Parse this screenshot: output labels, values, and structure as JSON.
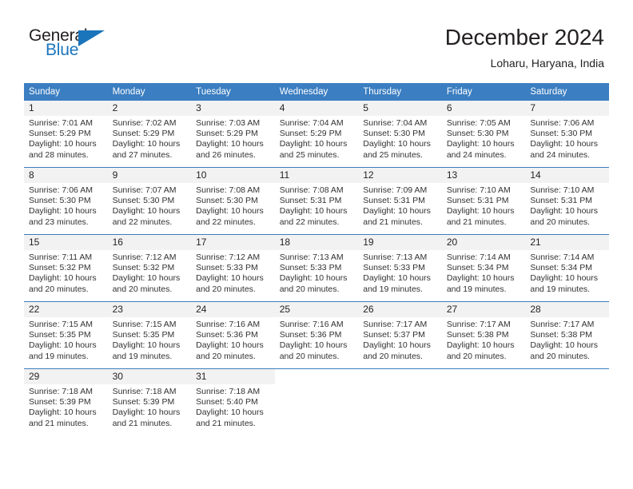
{
  "brand": {
    "name_part1": "General",
    "name_part2": "Blue",
    "accent_color": "#1b75bb",
    "logo_icon": "triangle-flag-icon"
  },
  "header": {
    "month_title": "December 2024",
    "location": "Loharu, Haryana, India"
  },
  "calendar": {
    "header_bg_color": "#3b7ec1",
    "daynum_bg_color": "#f2f2f2",
    "weekday_headers": [
      "Sunday",
      "Monday",
      "Tuesday",
      "Wednesday",
      "Thursday",
      "Friday",
      "Saturday"
    ],
    "weeks": [
      [
        {
          "day": "1",
          "sunrise": "Sunrise: 7:01 AM",
          "sunset": "Sunset: 5:29 PM",
          "daylight_line1": "Daylight: 10 hours",
          "daylight_line2": "and 28 minutes."
        },
        {
          "day": "2",
          "sunrise": "Sunrise: 7:02 AM",
          "sunset": "Sunset: 5:29 PM",
          "daylight_line1": "Daylight: 10 hours",
          "daylight_line2": "and 27 minutes."
        },
        {
          "day": "3",
          "sunrise": "Sunrise: 7:03 AM",
          "sunset": "Sunset: 5:29 PM",
          "daylight_line1": "Daylight: 10 hours",
          "daylight_line2": "and 26 minutes."
        },
        {
          "day": "4",
          "sunrise": "Sunrise: 7:04 AM",
          "sunset": "Sunset: 5:29 PM",
          "daylight_line1": "Daylight: 10 hours",
          "daylight_line2": "and 25 minutes."
        },
        {
          "day": "5",
          "sunrise": "Sunrise: 7:04 AM",
          "sunset": "Sunset: 5:30 PM",
          "daylight_line1": "Daylight: 10 hours",
          "daylight_line2": "and 25 minutes."
        },
        {
          "day": "6",
          "sunrise": "Sunrise: 7:05 AM",
          "sunset": "Sunset: 5:30 PM",
          "daylight_line1": "Daylight: 10 hours",
          "daylight_line2": "and 24 minutes."
        },
        {
          "day": "7",
          "sunrise": "Sunrise: 7:06 AM",
          "sunset": "Sunset: 5:30 PM",
          "daylight_line1": "Daylight: 10 hours",
          "daylight_line2": "and 24 minutes."
        }
      ],
      [
        {
          "day": "8",
          "sunrise": "Sunrise: 7:06 AM",
          "sunset": "Sunset: 5:30 PM",
          "daylight_line1": "Daylight: 10 hours",
          "daylight_line2": "and 23 minutes."
        },
        {
          "day": "9",
          "sunrise": "Sunrise: 7:07 AM",
          "sunset": "Sunset: 5:30 PM",
          "daylight_line1": "Daylight: 10 hours",
          "daylight_line2": "and 22 minutes."
        },
        {
          "day": "10",
          "sunrise": "Sunrise: 7:08 AM",
          "sunset": "Sunset: 5:30 PM",
          "daylight_line1": "Daylight: 10 hours",
          "daylight_line2": "and 22 minutes."
        },
        {
          "day": "11",
          "sunrise": "Sunrise: 7:08 AM",
          "sunset": "Sunset: 5:31 PM",
          "daylight_line1": "Daylight: 10 hours",
          "daylight_line2": "and 22 minutes."
        },
        {
          "day": "12",
          "sunrise": "Sunrise: 7:09 AM",
          "sunset": "Sunset: 5:31 PM",
          "daylight_line1": "Daylight: 10 hours",
          "daylight_line2": "and 21 minutes."
        },
        {
          "day": "13",
          "sunrise": "Sunrise: 7:10 AM",
          "sunset": "Sunset: 5:31 PM",
          "daylight_line1": "Daylight: 10 hours",
          "daylight_line2": "and 21 minutes."
        },
        {
          "day": "14",
          "sunrise": "Sunrise: 7:10 AM",
          "sunset": "Sunset: 5:31 PM",
          "daylight_line1": "Daylight: 10 hours",
          "daylight_line2": "and 20 minutes."
        }
      ],
      [
        {
          "day": "15",
          "sunrise": "Sunrise: 7:11 AM",
          "sunset": "Sunset: 5:32 PM",
          "daylight_line1": "Daylight: 10 hours",
          "daylight_line2": "and 20 minutes."
        },
        {
          "day": "16",
          "sunrise": "Sunrise: 7:12 AM",
          "sunset": "Sunset: 5:32 PM",
          "daylight_line1": "Daylight: 10 hours",
          "daylight_line2": "and 20 minutes."
        },
        {
          "day": "17",
          "sunrise": "Sunrise: 7:12 AM",
          "sunset": "Sunset: 5:33 PM",
          "daylight_line1": "Daylight: 10 hours",
          "daylight_line2": "and 20 minutes."
        },
        {
          "day": "18",
          "sunrise": "Sunrise: 7:13 AM",
          "sunset": "Sunset: 5:33 PM",
          "daylight_line1": "Daylight: 10 hours",
          "daylight_line2": "and 20 minutes."
        },
        {
          "day": "19",
          "sunrise": "Sunrise: 7:13 AM",
          "sunset": "Sunset: 5:33 PM",
          "daylight_line1": "Daylight: 10 hours",
          "daylight_line2": "and 19 minutes."
        },
        {
          "day": "20",
          "sunrise": "Sunrise: 7:14 AM",
          "sunset": "Sunset: 5:34 PM",
          "daylight_line1": "Daylight: 10 hours",
          "daylight_line2": "and 19 minutes."
        },
        {
          "day": "21",
          "sunrise": "Sunrise: 7:14 AM",
          "sunset": "Sunset: 5:34 PM",
          "daylight_line1": "Daylight: 10 hours",
          "daylight_line2": "and 19 minutes."
        }
      ],
      [
        {
          "day": "22",
          "sunrise": "Sunrise: 7:15 AM",
          "sunset": "Sunset: 5:35 PM",
          "daylight_line1": "Daylight: 10 hours",
          "daylight_line2": "and 19 minutes."
        },
        {
          "day": "23",
          "sunrise": "Sunrise: 7:15 AM",
          "sunset": "Sunset: 5:35 PM",
          "daylight_line1": "Daylight: 10 hours",
          "daylight_line2": "and 19 minutes."
        },
        {
          "day": "24",
          "sunrise": "Sunrise: 7:16 AM",
          "sunset": "Sunset: 5:36 PM",
          "daylight_line1": "Daylight: 10 hours",
          "daylight_line2": "and 20 minutes."
        },
        {
          "day": "25",
          "sunrise": "Sunrise: 7:16 AM",
          "sunset": "Sunset: 5:36 PM",
          "daylight_line1": "Daylight: 10 hours",
          "daylight_line2": "and 20 minutes."
        },
        {
          "day": "26",
          "sunrise": "Sunrise: 7:17 AM",
          "sunset": "Sunset: 5:37 PM",
          "daylight_line1": "Daylight: 10 hours",
          "daylight_line2": "and 20 minutes."
        },
        {
          "day": "27",
          "sunrise": "Sunrise: 7:17 AM",
          "sunset": "Sunset: 5:38 PM",
          "daylight_line1": "Daylight: 10 hours",
          "daylight_line2": "and 20 minutes."
        },
        {
          "day": "28",
          "sunrise": "Sunrise: 7:17 AM",
          "sunset": "Sunset: 5:38 PM",
          "daylight_line1": "Daylight: 10 hours",
          "daylight_line2": "and 20 minutes."
        }
      ],
      [
        {
          "day": "29",
          "sunrise": "Sunrise: 7:18 AM",
          "sunset": "Sunset: 5:39 PM",
          "daylight_line1": "Daylight: 10 hours",
          "daylight_line2": "and 21 minutes."
        },
        {
          "day": "30",
          "sunrise": "Sunrise: 7:18 AM",
          "sunset": "Sunset: 5:39 PM",
          "daylight_line1": "Daylight: 10 hours",
          "daylight_line2": "and 21 minutes."
        },
        {
          "day": "31",
          "sunrise": "Sunrise: 7:18 AM",
          "sunset": "Sunset: 5:40 PM",
          "daylight_line1": "Daylight: 10 hours",
          "daylight_line2": "and 21 minutes."
        },
        {
          "day": "",
          "sunrise": "",
          "sunset": "",
          "daylight_line1": "",
          "daylight_line2": ""
        },
        {
          "day": "",
          "sunrise": "",
          "sunset": "",
          "daylight_line1": "",
          "daylight_line2": ""
        },
        {
          "day": "",
          "sunrise": "",
          "sunset": "",
          "daylight_line1": "",
          "daylight_line2": ""
        },
        {
          "day": "",
          "sunrise": "",
          "sunset": "",
          "daylight_line1": "",
          "daylight_line2": ""
        }
      ]
    ]
  }
}
